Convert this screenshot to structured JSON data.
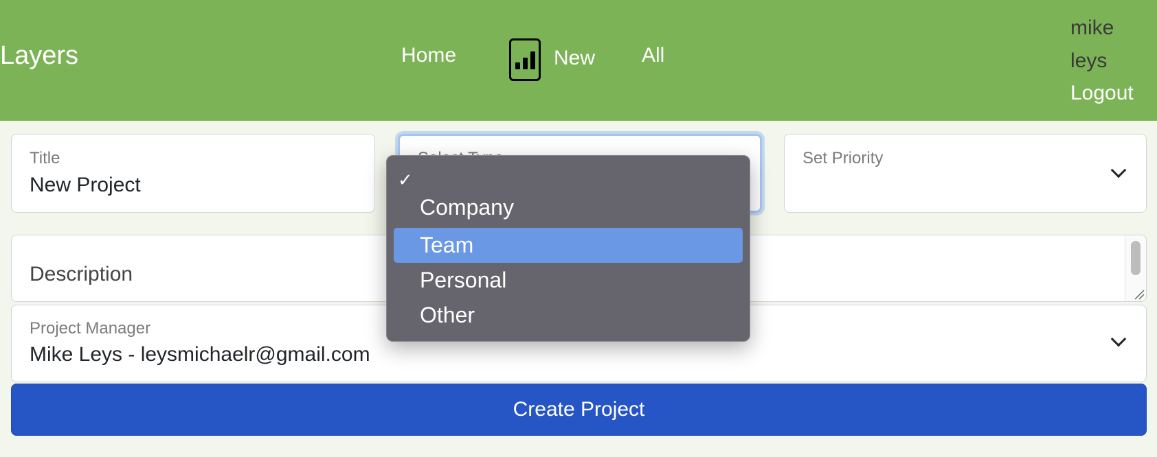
{
  "navbar": {
    "brand": "Layers",
    "links": {
      "home": "Home",
      "new": "New",
      "all": "All"
    },
    "user": {
      "first_name": "mike",
      "last_name": "leys",
      "logout": "Logout"
    }
  },
  "form": {
    "title": {
      "label": "Title",
      "value": "New Project"
    },
    "type": {
      "placeholder": "Select Type"
    },
    "priority": {
      "placeholder": "Set Priority"
    },
    "description": {
      "placeholder": "Description"
    },
    "project_manager": {
      "label": "Project Manager",
      "value": "Mike Leys - leysmichaelr@gmail.com"
    },
    "submit_label": "Create Project"
  },
  "type_dropdown": {
    "check_glyph": "✓",
    "options": [
      "Company",
      "Team",
      "Personal",
      "Other"
    ],
    "highlighted": "Team"
  },
  "colors": {
    "navbar": "#7cb356",
    "primary_button": "#2656c5",
    "dropdown_bg": "#66646c",
    "highlight": "#6b98e4"
  }
}
